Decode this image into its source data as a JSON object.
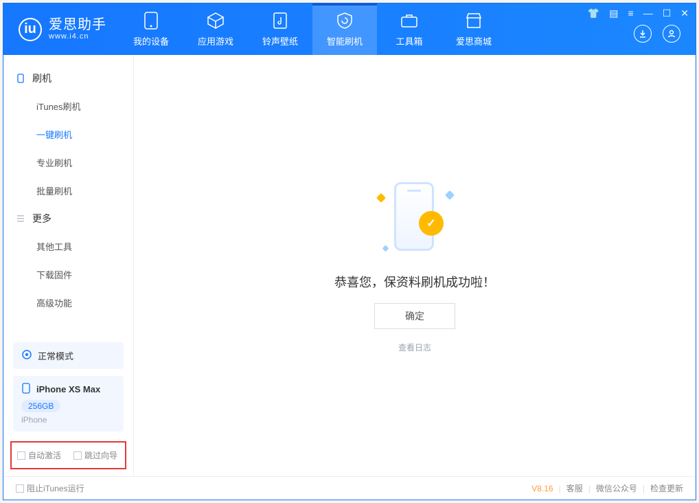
{
  "brand": {
    "title": "爱思助手",
    "url": "www.i4.cn"
  },
  "topnav": {
    "items": [
      {
        "label": "我的设备"
      },
      {
        "label": "应用游戏"
      },
      {
        "label": "铃声壁纸"
      },
      {
        "label": "智能刷机"
      },
      {
        "label": "工具箱"
      },
      {
        "label": "爱思商城"
      }
    ]
  },
  "sidebar": {
    "group1_title": "刷机",
    "group1_items": [
      {
        "label": "iTunes刷机"
      },
      {
        "label": "一键刷机"
      },
      {
        "label": "专业刷机"
      },
      {
        "label": "批量刷机"
      }
    ],
    "group2_title": "更多",
    "group2_items": [
      {
        "label": "其他工具"
      },
      {
        "label": "下载固件"
      },
      {
        "label": "高级功能"
      }
    ]
  },
  "device": {
    "mode_label": "正常模式",
    "name": "iPhone XS Max",
    "capacity": "256GB",
    "type": "iPhone"
  },
  "options": {
    "auto_activate": "自动激活",
    "skip_guide": "跳过向导"
  },
  "main": {
    "success_text": "恭喜您，保资料刷机成功啦！",
    "ok_label": "确定",
    "log_link": "查看日志"
  },
  "status": {
    "block_itunes": "阻止iTunes运行",
    "version": "V8.16",
    "support": "客服",
    "wechat": "微信公众号",
    "update": "检查更新"
  }
}
